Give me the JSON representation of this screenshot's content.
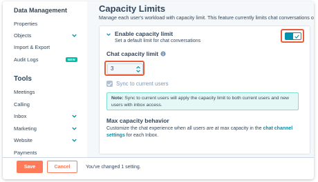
{
  "sidebar": {
    "data_management_heading": "Data Management",
    "items_top": [
      {
        "label": "Properties",
        "chevron": false
      },
      {
        "label": "Objects",
        "chevron": true
      },
      {
        "label": "Import & Export",
        "chevron": false
      },
      {
        "label": "Audit Logs",
        "badge": "NEW"
      }
    ],
    "tools_heading": "Tools",
    "items_tools": [
      {
        "label": "Meetings",
        "chevron": false
      },
      {
        "label": "Calling",
        "chevron": false
      },
      {
        "label": "Inbox",
        "chevron": true
      },
      {
        "label": "Marketing",
        "chevron": true
      },
      {
        "label": "Website",
        "chevron": true
      },
      {
        "label": "Payments",
        "chevron": false
      }
    ]
  },
  "main": {
    "title": "Capacity Limits",
    "description": "Manage each user's workload with capacity limit. This feature currently limits chat conversations only.",
    "enable": {
      "title": "Enable capacity limit",
      "subtitle": "Set a default limit for chat conversations",
      "toggle_on": true
    },
    "capacity": {
      "label": "Chat capacity limit",
      "value": "3"
    },
    "sync": {
      "label": "Sync to current users",
      "checked": true
    },
    "note": {
      "prefix": "Note:",
      "text": " Sync to current users will apply the capacity limit to both current users and new users with inbox access."
    },
    "max": {
      "title": "Max capacity behavior",
      "text_before": "Customize the chat experience when all users are at max capacity in the ",
      "link": "chat channel settings",
      "text_after": " for each Inbox."
    }
  },
  "footer": {
    "save_label": "Save",
    "cancel_label": "Cancel",
    "status": "You've changed 1 setting."
  },
  "colors": {
    "accent": "#ff7a59",
    "toggle": "#0091ae",
    "highlight": "#e85c3a",
    "note_bg": "#e5f8f6",
    "badge": "#00bda5"
  }
}
